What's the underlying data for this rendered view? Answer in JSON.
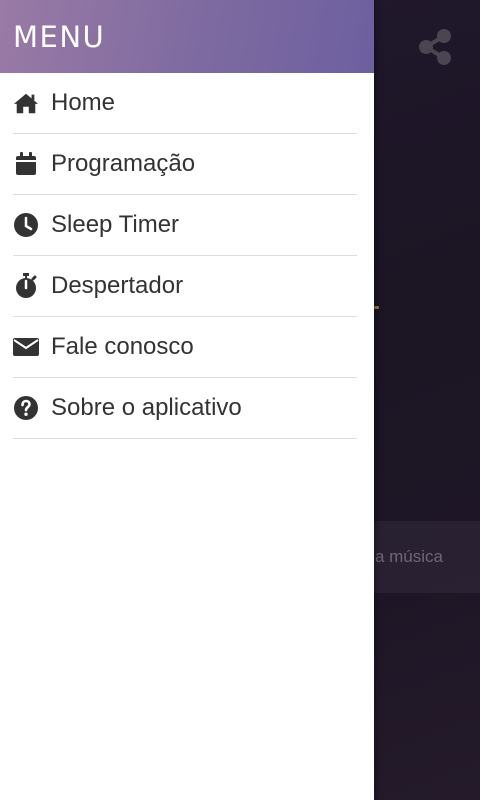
{
  "drawer": {
    "title": "MENU",
    "items": [
      {
        "label": "Home",
        "icon": "home-icon"
      },
      {
        "label": "Programação",
        "icon": "calendar-icon"
      },
      {
        "label": "Sleep Timer",
        "icon": "clock-icon"
      },
      {
        "label": "Despertador",
        "icon": "stopwatch-icon"
      },
      {
        "label": "Fale conosco",
        "icon": "envelope-icon"
      },
      {
        "label": "Sobre o aplicativo",
        "icon": "question-circle-icon"
      }
    ]
  },
  "background": {
    "share_icon": "share-icon",
    "partial_text": "a música"
  },
  "colors": {
    "header_start": "#9a7aa6",
    "header_end": "#6d5fa0",
    "icon": "#333333",
    "text": "#333333",
    "divider": "#dcdcdc",
    "background": "#1b1524"
  }
}
